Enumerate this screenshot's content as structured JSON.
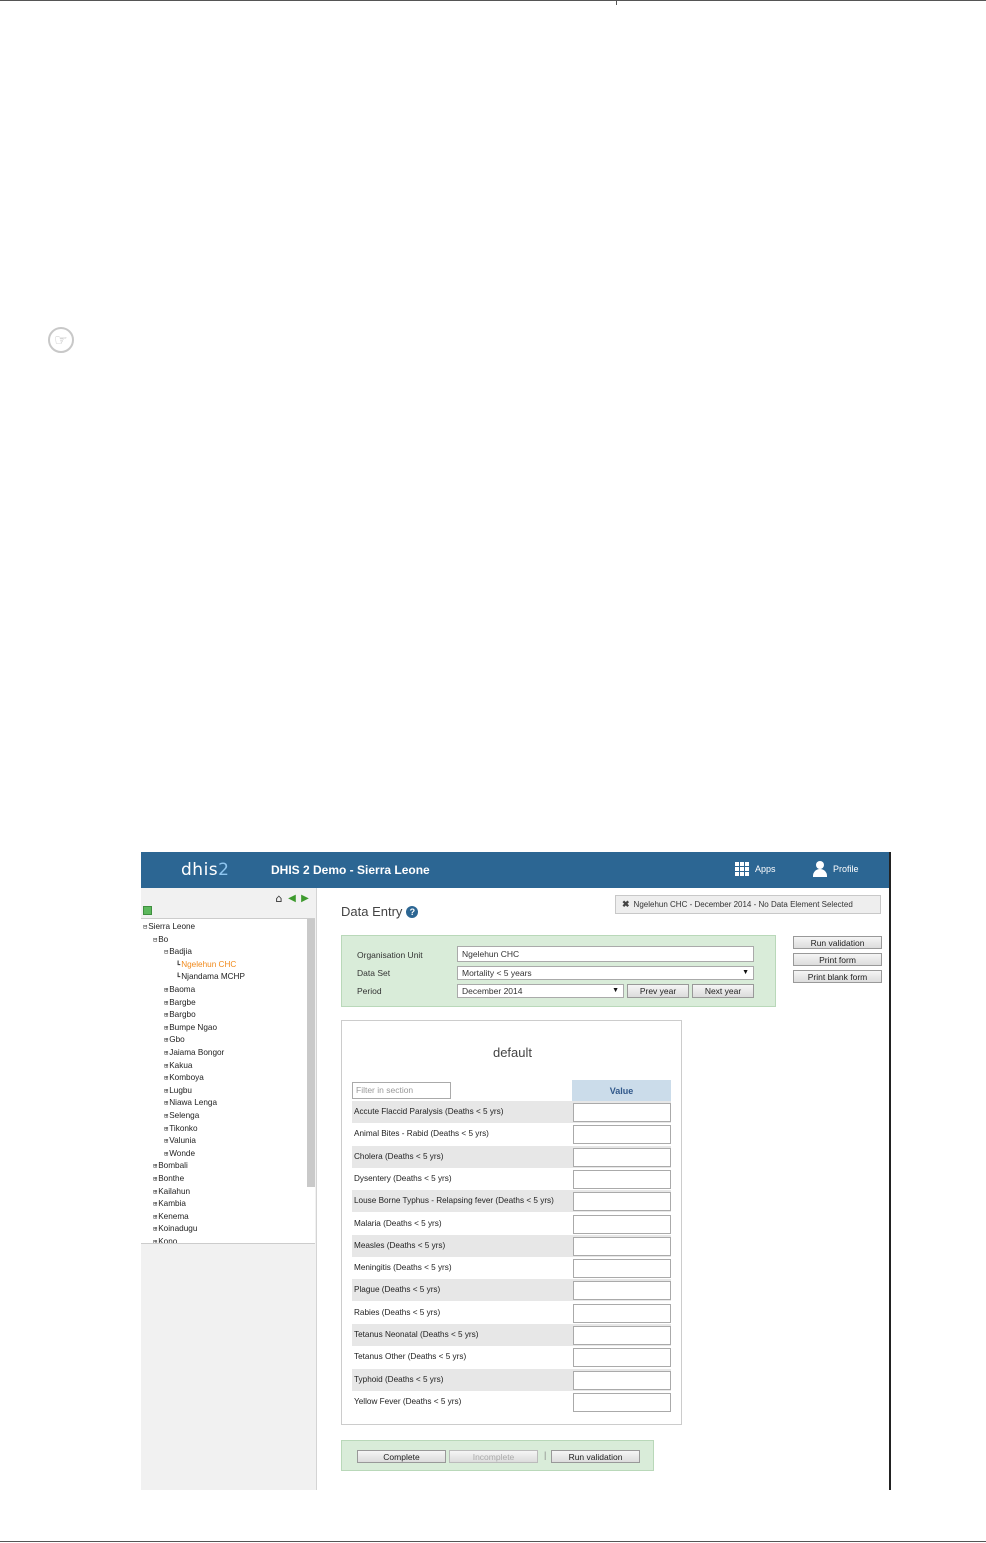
{
  "header": {
    "brand_main": "dhis",
    "brand_num": "2",
    "app_title": "DHIS 2 Demo - Sierra Leone",
    "apps_label": "Apps",
    "profile_label": "Profile",
    "brand_color": "#2c6693"
  },
  "sidebar": {
    "tree": [
      {
        "label": "Sierra Leone",
        "marker": "⊟",
        "level": 0
      },
      {
        "label": "Bo",
        "marker": "⊟",
        "level": 1
      },
      {
        "label": "Badjia",
        "marker": "⊟",
        "level": 2
      },
      {
        "label": "Ngelehun CHC",
        "marker": "┗",
        "level": 3,
        "selected": true
      },
      {
        "label": "Njandama MCHP",
        "marker": "┗",
        "level": 3
      },
      {
        "label": "Baoma",
        "marker": "⊞",
        "level": 2
      },
      {
        "label": "Bargbe",
        "marker": "⊞",
        "level": 2
      },
      {
        "label": "Bargbo",
        "marker": "⊞",
        "level": 2
      },
      {
        "label": "Bumpe Ngao",
        "marker": "⊞",
        "level": 2
      },
      {
        "label": "Gbo",
        "marker": "⊞",
        "level": 2
      },
      {
        "label": "Jaiama Bongor",
        "marker": "⊞",
        "level": 2
      },
      {
        "label": "Kakua",
        "marker": "⊞",
        "level": 2
      },
      {
        "label": "Komboya",
        "marker": "⊞",
        "level": 2
      },
      {
        "label": "Lugbu",
        "marker": "⊞",
        "level": 2
      },
      {
        "label": "Niawa Lenga",
        "marker": "⊞",
        "level": 2
      },
      {
        "label": "Selenga",
        "marker": "⊞",
        "level": 2
      },
      {
        "label": "Tikonko",
        "marker": "⊞",
        "level": 2
      },
      {
        "label": "Valunia",
        "marker": "⊞",
        "level": 2
      },
      {
        "label": "Wonde",
        "marker": "⊞",
        "level": 2
      },
      {
        "label": "Bombali",
        "marker": "⊞",
        "level": 1
      },
      {
        "label": "Bonthe",
        "marker": "⊞",
        "level": 1
      },
      {
        "label": "Kailahun",
        "marker": "⊞",
        "level": 1
      },
      {
        "label": "Kambia",
        "marker": "⊞",
        "level": 1
      },
      {
        "label": "Kenema",
        "marker": "⊞",
        "level": 1
      },
      {
        "label": "Koinadugu",
        "marker": "⊞",
        "level": 1
      },
      {
        "label": "Kono",
        "marker": "⊞",
        "level": 1
      }
    ],
    "selected_color": "#f08a1c"
  },
  "main": {
    "title": "Data Entry",
    "help_glyph": "?",
    "status_x": "✖",
    "status": "Ngelehun CHC - December 2014 - No Data Element Selected",
    "org_unit_label": "Organisation Unit",
    "org_unit_value": "Ngelehun CHC",
    "dataset_label": "Data Set",
    "dataset_value": "Mortality < 5 years",
    "period_label": "Period",
    "period_value": "December 2014",
    "prev_year": "Prev year",
    "next_year": "Next year",
    "run_validation": "Run validation",
    "print_form": "Print form",
    "print_blank_form": "Print blank form",
    "section_title": "default",
    "filter_placeholder": "Filter in section",
    "value_header": "Value",
    "rows": [
      "Accute Flaccid Paralysis (Deaths < 5 yrs)",
      "Animal Bites - Rabid (Deaths < 5 yrs)",
      "Cholera (Deaths < 5 yrs)",
      "Dysentery (Deaths < 5 yrs)",
      "Louse Borne Typhus - Relapsing fever (Deaths < 5 yrs)",
      "Malaria (Deaths < 5 yrs)",
      "Measles (Deaths < 5 yrs)",
      "Meningitis (Deaths < 5 yrs)",
      "Plague (Deaths < 5 yrs)",
      "Rabies (Deaths < 5 yrs)",
      "Tetanus Neonatal (Deaths < 5 yrs)",
      "Tetanus Other (Deaths < 5 yrs)",
      "Typhoid (Deaths < 5 yrs)",
      "Yellow Fever (Deaths < 5 yrs)"
    ],
    "complete": "Complete",
    "incomplete": "Incomplete",
    "separator": "|",
    "run_validation_bottom": "Run validation"
  },
  "page": {
    "note_glyph": "☞"
  }
}
